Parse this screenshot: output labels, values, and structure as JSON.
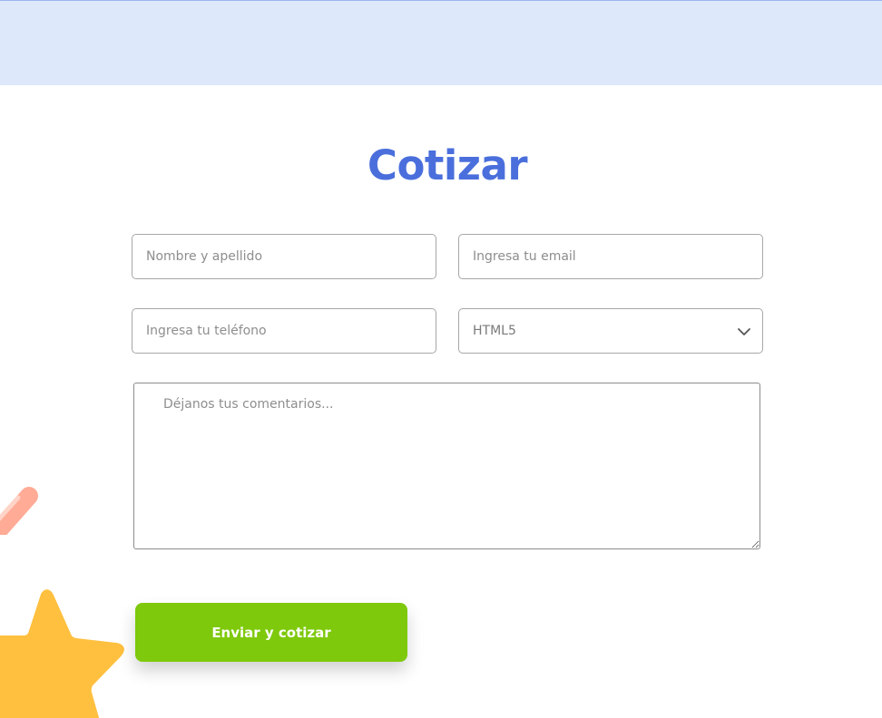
{
  "colors": {
    "title": "#4a6fdc",
    "button_bg": "#7ec90c",
    "band": "#dde9fb",
    "star": "#ffc03f",
    "pencil": "#ffab96"
  },
  "section": {
    "title": "Cotizar"
  },
  "form": {
    "name_placeholder": "Nombre y apellido",
    "email_placeholder": "Ingresa tu email",
    "phone_placeholder": "Ingresa tu teléfono",
    "service_selected": "HTML5",
    "comments_placeholder": "Déjanos tus comentarios...",
    "submit_label": "Enviar y cotizar"
  },
  "icons": {
    "select_arrow": "chevron-down-icon",
    "decor_star": "star-icon",
    "decor_pencil": "pencil-icon"
  }
}
